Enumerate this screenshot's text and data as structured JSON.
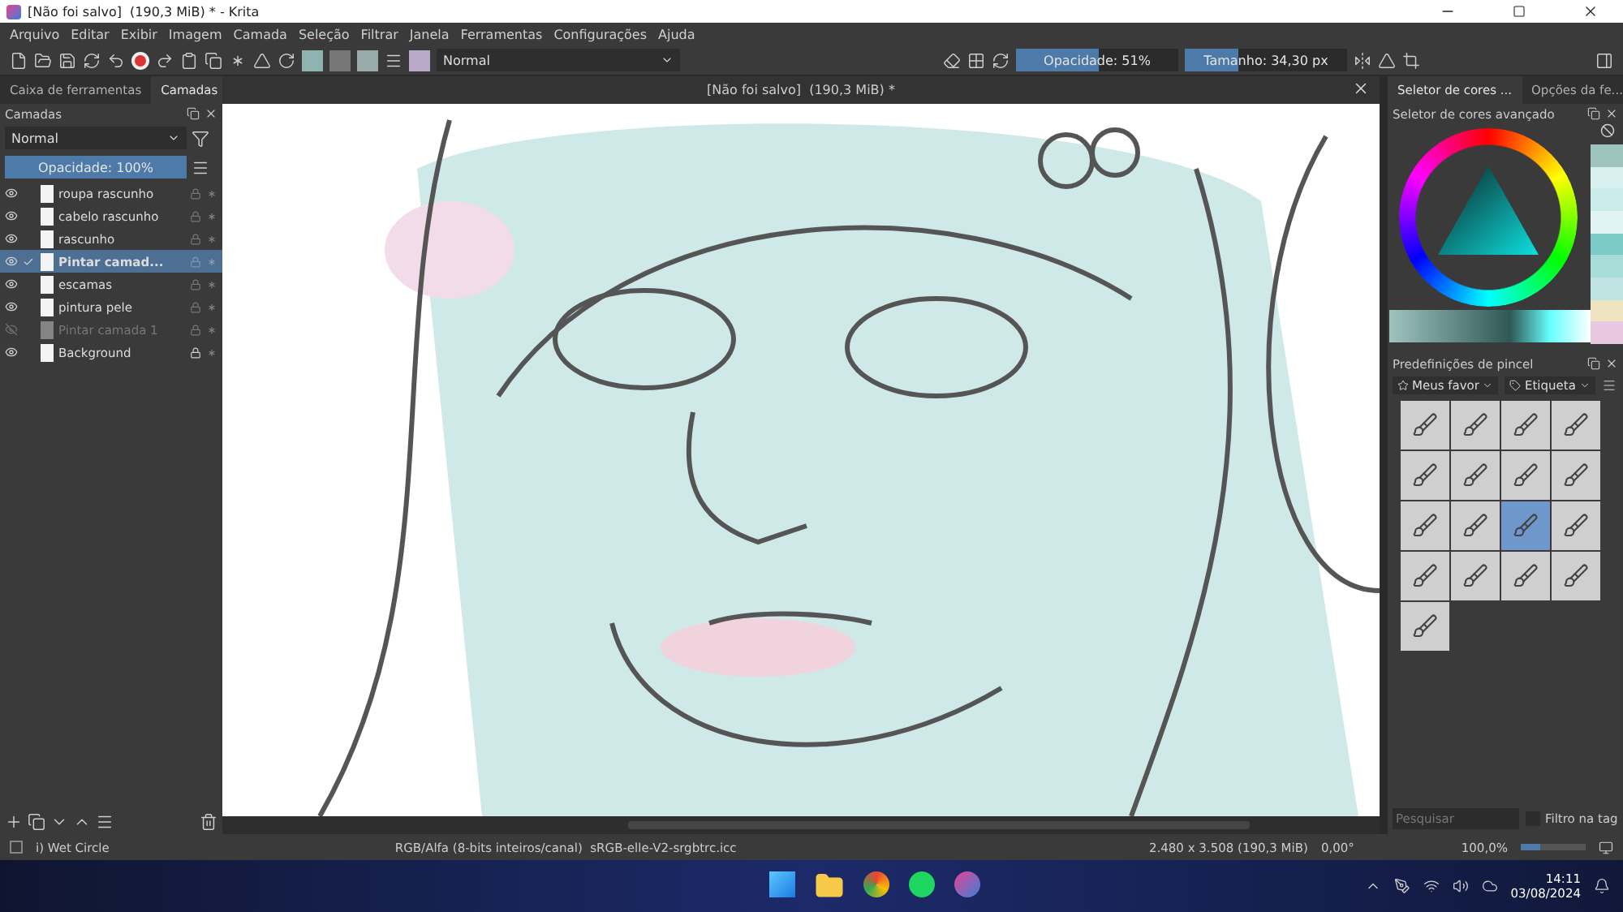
{
  "window": {
    "title": "[Não foi salvo]  (190,3 MiB) * - Krita"
  },
  "menu": [
    "Arquivo",
    "Editar",
    "Exibir",
    "Imagem",
    "Camada",
    "Seleção",
    "Filtrar",
    "Janela",
    "Ferramentas",
    "Configurações",
    "Ajuda"
  ],
  "toolbar": {
    "blend_mode": "Normal",
    "opacity": {
      "label": "Opacidade: 51%",
      "level": 0.51
    },
    "size": {
      "label": "Tamanho: 34,30 px",
      "level": 0.33
    }
  },
  "left_panel": {
    "tabs": [
      {
        "label": "Caixa de ferramentas",
        "selected": false
      },
      {
        "label": "Camadas",
        "selected": true
      }
    ],
    "title": "Camadas",
    "blend_mode": "Normal",
    "opacity": {
      "label": "Opacidade: 100%",
      "level": 1
    },
    "layers": [
      {
        "name": "roupa rascunho",
        "visible": true,
        "selected": false,
        "locked": false
      },
      {
        "name": "cabelo rascunho",
        "visible": true,
        "selected": false,
        "locked": false
      },
      {
        "name": "rascunho",
        "visible": true,
        "selected": false,
        "locked": false
      },
      {
        "name": "Pintar camad...",
        "visible": true,
        "selected": true,
        "locked": false
      },
      {
        "name": "escamas",
        "visible": true,
        "selected": false,
        "locked": false
      },
      {
        "name": "pintura pele",
        "visible": true,
        "selected": false,
        "locked": false
      },
      {
        "name": "Pintar camada 1",
        "visible": false,
        "selected": false,
        "locked": false
      },
      {
        "name": "Background",
        "visible": true,
        "selected": false,
        "locked": true
      }
    ]
  },
  "document": {
    "title": "[Não foi salvo]  (190,3 MiB) *"
  },
  "right_panel": {
    "tabs": [
      {
        "label": "Seletor de cores ...",
        "selected": true
      },
      {
        "label": "Opções da fe...",
        "selected": false
      }
    ],
    "color_selector": {
      "title": "Seletor de cores avançado",
      "recent_colors": [
        {
          "color": "#9fc4c0"
        },
        {
          "color": "#d8f0ef"
        },
        {
          "color": "#c9eceb"
        },
        {
          "color": "#e0f4f3"
        },
        {
          "color": "#7ccbc8"
        },
        {
          "color": "#a8dcd9"
        },
        {
          "color": "#bfe3e0"
        },
        {
          "color": "#f0e4c0"
        },
        {
          "color": "#e8c8e0"
        }
      ]
    },
    "brush_presets": {
      "title": "Predefinições de pincel",
      "favorites": "Meus favor",
      "tag": "Etiqueta",
      "presets": [
        {
          "selected": false
        },
        {
          "selected": false
        },
        {
          "selected": false
        },
        {
          "selected": false
        },
        {
          "selected": false
        },
        {
          "selected": false
        },
        {
          "selected": false
        },
        {
          "selected": false
        },
        {
          "selected": false
        },
        {
          "selected": false
        },
        {
          "selected": true
        },
        {
          "selected": false
        },
        {
          "selected": false
        },
        {
          "selected": false
        },
        {
          "selected": false
        },
        {
          "selected": false
        },
        {
          "selected": false
        }
      ],
      "search": {
        "placeholder": "Pesquisar"
      },
      "tag_filter": {
        "label": "Filtro na tag",
        "checked": false
      }
    }
  },
  "status_bar": {
    "brush": "i) Wet Circle",
    "color_space": "RGB/Alfa (8-bits inteiros/canal)  sRGB-elle-V2-srgbtrc.icc",
    "image_size": "2.480 x 3.508 (190,3 MiB)",
    "rotation": "0,00°",
    "zoom": "100,0%",
    "zoom_slider": {
      "level": 0.3
    }
  },
  "taskbar": {
    "time": "14:11",
    "date": "03/08/2024"
  }
}
